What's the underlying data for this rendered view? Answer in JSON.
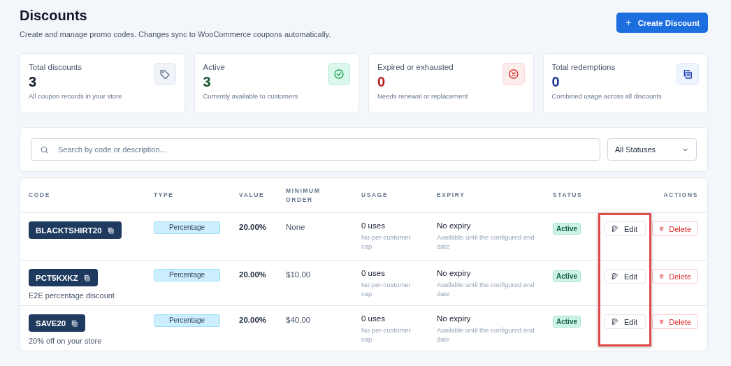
{
  "header": {
    "title": "Discounts",
    "subtitle": "Create and manage promo codes. Changes sync to WooCommerce coupons automatically.",
    "create_button": "Create Discount"
  },
  "stats": [
    {
      "label": "Total discounts",
      "value": "3",
      "note": "All coupon records in your store",
      "kind": "total"
    },
    {
      "label": "Active",
      "value": "3",
      "note": "Currently available to customers",
      "kind": "active"
    },
    {
      "label": "Expired or exhausted",
      "value": "0",
      "note": "Needs renewal or replacement",
      "kind": "expired"
    },
    {
      "label": "Total redemptions",
      "value": "0",
      "note": "Combined usage across all discounts",
      "kind": "redemptions"
    }
  ],
  "filters": {
    "search_placeholder": "Search by code or description...",
    "status_filter": "All Statuses"
  },
  "table": {
    "columns": [
      "CODE",
      "TYPE",
      "VALUE",
      "MINIMUM ORDER",
      "USAGE",
      "EXPIRY",
      "STATUS",
      "ACTIONS"
    ],
    "edit_buttons_highlighted": true,
    "rows": [
      {
        "code": "BLACKTSHIRT20",
        "description": null,
        "type": "Percentage",
        "value": "20.00%",
        "minimum_order": "None",
        "usage": "0 uses",
        "usage_note": "No per-customer cap",
        "expiry": "No expiry",
        "expiry_note": "Available until the configured end date",
        "status": "Active",
        "status_active": true,
        "edit": "Edit",
        "delete": "Delete"
      },
      {
        "code": "PCT5KXKZ",
        "description": "E2E percentage discount",
        "type": "Percentage",
        "value": "20.00%",
        "minimum_order": "$10.00",
        "usage": "0 uses",
        "usage_note": "No per-customer cap",
        "expiry": "No expiry",
        "expiry_note": "Available until the configured end date",
        "status": "Active",
        "status_active": true,
        "edit": "Edit",
        "delete": "Delete"
      },
      {
        "code": "SAVE20",
        "description": "20% off on your store",
        "type": "Percentage",
        "value": "20.00%",
        "minimum_order": "$40.00",
        "usage": "0 uses",
        "usage_note": "No per-customer cap",
        "expiry": "No expiry",
        "expiry_note": "Available until the configured end date",
        "status": "Active",
        "status_active": true,
        "edit": "Edit",
        "delete": "Delete"
      }
    ]
  }
}
